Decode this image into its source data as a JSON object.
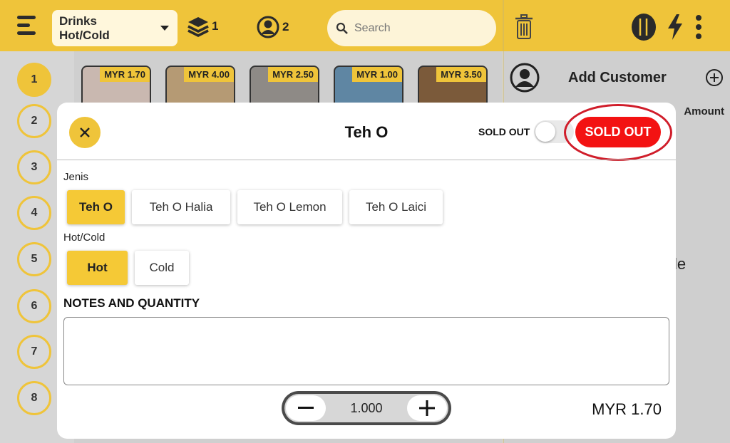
{
  "header": {
    "category_line1": "Drinks",
    "category_line2": "Hot/Cold",
    "layers_count": "1",
    "people_count": "2",
    "search_placeholder": "Search"
  },
  "sidebar": {
    "numbers": [
      "1",
      "2",
      "3",
      "4",
      "5",
      "6",
      "7",
      "8"
    ]
  },
  "products": [
    {
      "price": "MYR 1.70"
    },
    {
      "price": "MYR 4.00"
    },
    {
      "price": "MYR 2.50"
    },
    {
      "price": "MYR 1.00"
    },
    {
      "price": "MYR 3.50"
    }
  ],
  "right_panel": {
    "add_customer": "Add Customer",
    "amount_header": "Amount",
    "partial_text": "le"
  },
  "modal": {
    "title": "Teh O",
    "sold_out_toggle_label": "SOLD OUT",
    "sold_out_button": "SOLD OUT",
    "group1_label": "Jenis",
    "group1_options": [
      "Teh O",
      "Teh O Halia",
      "Teh O Lemon",
      "Teh O Laici"
    ],
    "group2_label": "Hot/Cold",
    "group2_options": [
      "Hot",
      "Cold"
    ],
    "notes_heading": "NOTES AND QUANTITY",
    "quantity": "1.000",
    "total": "MYR 1.70"
  },
  "colors": {
    "accent": "#efc43a",
    "sold_out": "#f31212"
  }
}
